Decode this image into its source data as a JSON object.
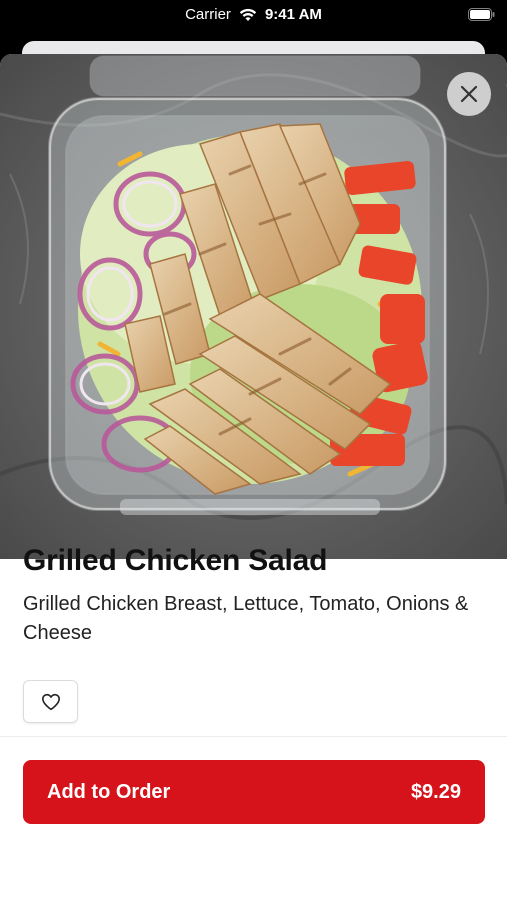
{
  "status_bar": {
    "carrier": "Carrier",
    "time": "9:41 AM",
    "wifi_icon": "wifi-icon",
    "battery_icon": "battery-icon"
  },
  "item": {
    "name": "Grilled Chicken Salad",
    "description": "Grilled Chicken Breast, Lettuce, Tomato, Onions & Cheese",
    "image_icon": "salad-photo"
  },
  "actions": {
    "close_icon": "close-icon",
    "favorite_icon": "heart-icon",
    "add_label": "Add to Order",
    "price": "$9.29"
  },
  "colors": {
    "accent": "#d6131a",
    "text": "#111111"
  }
}
